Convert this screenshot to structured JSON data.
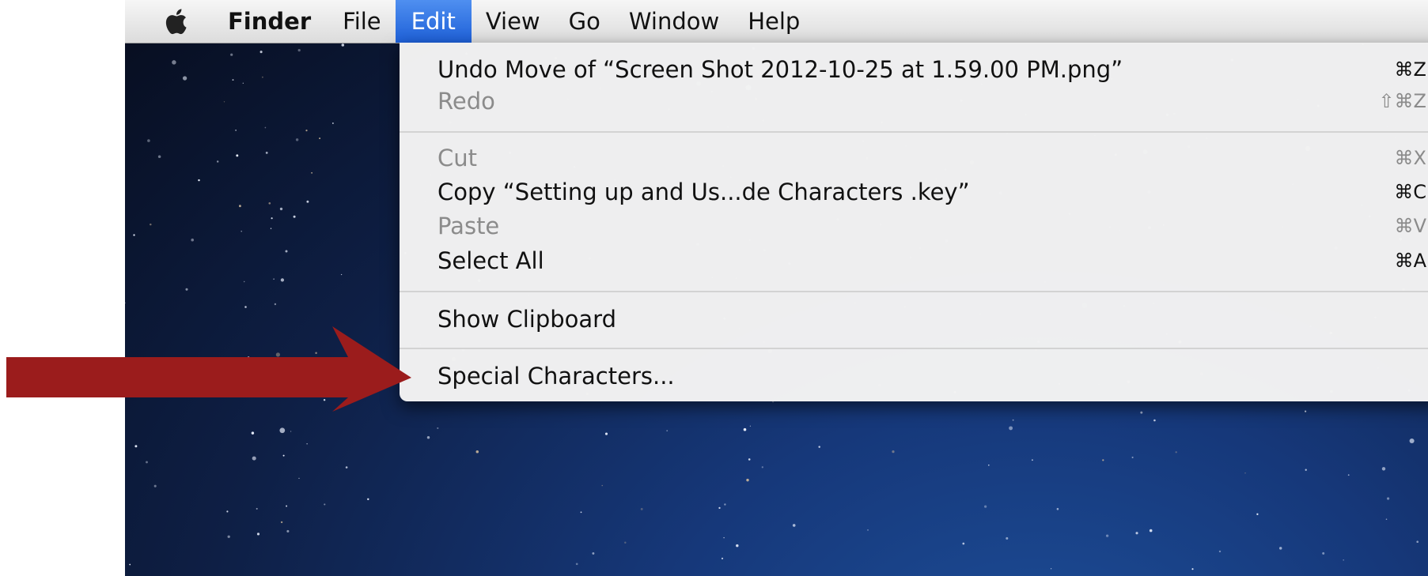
{
  "menubar": {
    "apple_icon": "apple-logo-icon",
    "items": [
      "Finder",
      "File",
      "Edit",
      "View",
      "Go",
      "Window",
      "Help"
    ],
    "active": "Edit"
  },
  "edit_menu": {
    "groups": [
      [
        {
          "label": "Undo Move of “Screen Shot 2012-10-25 at 1.59.00 PM.png”",
          "shortcut": "⌘Z",
          "enabled": true
        },
        {
          "label": "Redo",
          "shortcut": "⇧⌘Z",
          "enabled": false
        }
      ],
      [
        {
          "label": "Cut",
          "shortcut": "⌘X",
          "enabled": false
        },
        {
          "label": "Copy “Setting up and Us...de Characters .key”",
          "shortcut": "⌘C",
          "enabled": true
        },
        {
          "label": "Paste",
          "shortcut": "⌘V",
          "enabled": false
        },
        {
          "label": "Select All",
          "shortcut": "⌘A",
          "enabled": true
        }
      ],
      [
        {
          "label": "Show Clipboard",
          "shortcut": "",
          "enabled": true
        }
      ],
      [
        {
          "label": "Special Characters...",
          "shortcut": "",
          "enabled": true
        }
      ]
    ]
  },
  "annotation": {
    "arrow_color": "#9b1c1c",
    "points_to": "Special Characters..."
  },
  "colors": {
    "menu_highlight": "#2a6ee0",
    "disabled_text": "#8b8b8b"
  }
}
